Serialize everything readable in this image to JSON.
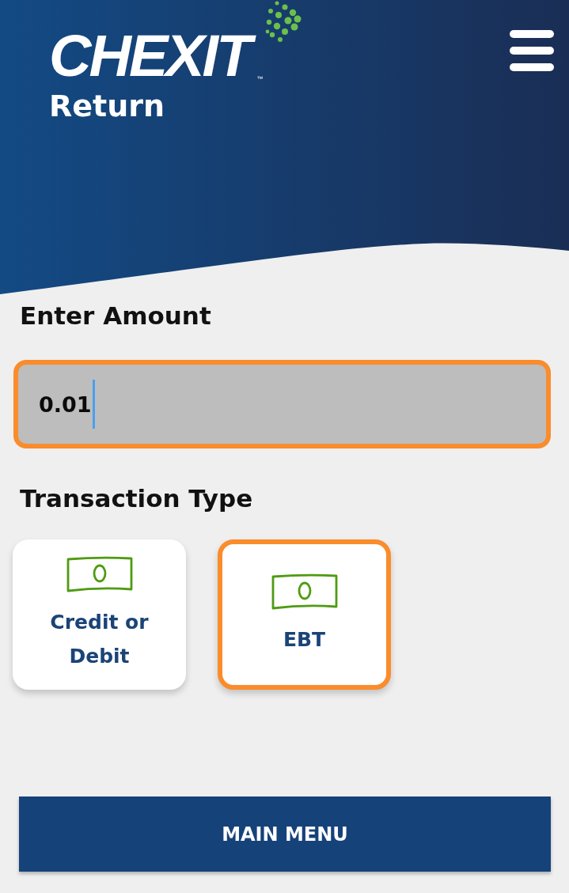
{
  "header": {
    "logo": "CHEXIT",
    "trademark": "™",
    "title": "Return"
  },
  "amount": {
    "label": "Enter Amount",
    "value": "0.01",
    "focused": true
  },
  "transaction_type": {
    "label": "Transaction Type",
    "options": [
      {
        "label": "Credit or Debit",
        "selected": false
      },
      {
        "label": "EBT",
        "selected": true
      }
    ]
  },
  "buttons": [
    {
      "label": "MAIN MENU"
    }
  ]
}
